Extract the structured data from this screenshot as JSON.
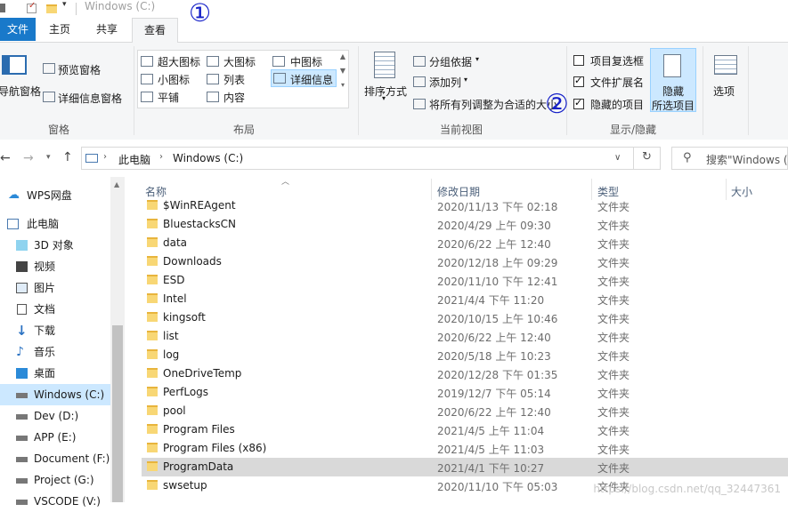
{
  "window": {
    "title": "Windows (C:)"
  },
  "tabs": {
    "file": "文件",
    "home": "主页",
    "share": "共享",
    "view": "查看"
  },
  "ribbon": {
    "panes": {
      "nav_pane": "导航窗格",
      "preview": "预览窗格",
      "details": "详细信息窗格",
      "group": "窗格"
    },
    "layout": {
      "items": [
        "超大图标",
        "大图标",
        "中图标",
        "小图标",
        "列表",
        "详细信息",
        "平铺",
        "内容"
      ],
      "selected": "详细信息",
      "group": "布局"
    },
    "current_view": {
      "sort": "排序方式",
      "group_by": "分组依据",
      "add_columns": "添加列",
      "fit_columns": "将所有列调整为合适的大小",
      "group": "当前视图"
    },
    "show_hide": {
      "item_checkbox": {
        "label": "项目复选框",
        "checked": false
      },
      "extensions": {
        "label": "文件扩展名",
        "checked": true
      },
      "hidden_items": {
        "label": "隐藏的项目",
        "checked": true
      },
      "hide_selected_l1": "隐藏",
      "hide_selected_l2": "所选项目",
      "group": "显示/隐藏"
    },
    "options": "选项"
  },
  "address": {
    "root": "此电脑",
    "current": "Windows (C:)",
    "search_placeholder": "搜索\"Windows ("
  },
  "nav": [
    {
      "label": "WPS网盘",
      "icon": "cloud-icon"
    },
    {
      "label": "此电脑",
      "icon": "computer-icon"
    },
    {
      "label": "3D 对象",
      "icon": "cube-icon"
    },
    {
      "label": "视频",
      "icon": "video-icon"
    },
    {
      "label": "图片",
      "icon": "picture-icon"
    },
    {
      "label": "文档",
      "icon": "document-icon"
    },
    {
      "label": "下载",
      "icon": "download-icon"
    },
    {
      "label": "音乐",
      "icon": "music-icon"
    },
    {
      "label": "桌面",
      "icon": "desktop-icon"
    },
    {
      "label": "Windows (C:)",
      "icon": "drive-icon",
      "selected": true
    },
    {
      "label": "Dev (D:)",
      "icon": "drive-icon"
    },
    {
      "label": "APP (E:)",
      "icon": "drive-icon"
    },
    {
      "label": "Document (F:)",
      "icon": "drive-icon"
    },
    {
      "label": "Project (G:)",
      "icon": "drive-icon"
    },
    {
      "label": "VSCODE (V:)",
      "icon": "drive-icon"
    }
  ],
  "columns": {
    "name": "名称",
    "modified": "修改日期",
    "type": "类型",
    "size": "大小"
  },
  "files": [
    {
      "name": "$WinREAgent",
      "date": "2020/11/13 下午 02:18",
      "type": "文件夹"
    },
    {
      "name": "BluestacksCN",
      "date": "2020/4/29 上午 09:30",
      "type": "文件夹"
    },
    {
      "name": "data",
      "date": "2020/6/22 上午 12:40",
      "type": "文件夹"
    },
    {
      "name": "Downloads",
      "date": "2020/12/18 上午 09:29",
      "type": "文件夹"
    },
    {
      "name": "ESD",
      "date": "2020/11/10 下午 12:41",
      "type": "文件夹"
    },
    {
      "name": "Intel",
      "date": "2021/4/4 下午 11:20",
      "type": "文件夹"
    },
    {
      "name": "kingsoft",
      "date": "2020/10/15 上午 10:46",
      "type": "文件夹"
    },
    {
      "name": "list",
      "date": "2020/6/22 上午 12:40",
      "type": "文件夹"
    },
    {
      "name": "log",
      "date": "2020/5/18 上午 10:23",
      "type": "文件夹"
    },
    {
      "name": "OneDriveTemp",
      "date": "2020/12/28 下午 01:35",
      "type": "文件夹"
    },
    {
      "name": "PerfLogs",
      "date": "2019/12/7 下午 05:14",
      "type": "文件夹"
    },
    {
      "name": "pool",
      "date": "2020/6/22 上午 12:40",
      "type": "文件夹"
    },
    {
      "name": "Program Files",
      "date": "2021/4/5 上午 11:04",
      "type": "文件夹"
    },
    {
      "name": "Program Files (x86)",
      "date": "2021/4/5 上午 11:03",
      "type": "文件夹"
    },
    {
      "name": "ProgramData",
      "date": "2021/4/1 下午 10:27",
      "type": "文件夹",
      "selected": true
    },
    {
      "name": "swsetup",
      "date": "2020/11/10 下午 05:03",
      "type": "文件夹"
    }
  ],
  "annotations": {
    "one": "①",
    "two": "②"
  },
  "watermark": "https://blog.csdn.net/qq_32447361"
}
